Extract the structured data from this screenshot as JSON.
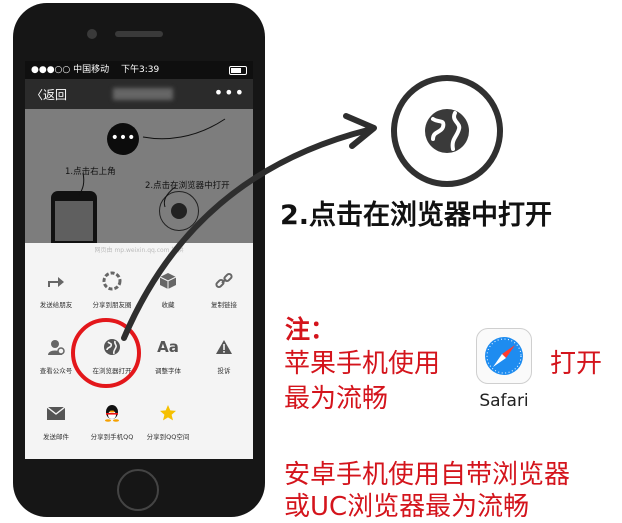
{
  "status_bar": {
    "carrier": "●●●○○ 中国移动 ",
    "time": "下午3:39"
  },
  "nav": {
    "back_label": "〈返回",
    "more_label": "•••"
  },
  "webview": {
    "step1_text": "1.点击右上角",
    "step2_text": "2.点击在浏览器中打开",
    "dots_label": "•••",
    "sheet_hint": "网页由 mp.weixin.qq.com 提供"
  },
  "menu": {
    "row1": [
      "发送给朋友",
      "分享到朋友圈",
      "收藏",
      "复制链接"
    ],
    "row2": [
      "查看公众号",
      "在浏览器打开",
      "调整字体",
      "投诉"
    ],
    "row3": [
      "发送邮件",
      "分享到手机QQ",
      "分享到QQ空间"
    ],
    "font_icon_text": "Aa"
  },
  "instruction": {
    "step2": "2.点击在浏览器中打开"
  },
  "notes": {
    "title": "注：",
    "apple_line1": "苹果手机使用",
    "apple_line2": "最为流畅",
    "open": "打开",
    "safari_label": "Safari",
    "android_line1": "安卓手机使用自带浏览器",
    "android_line2": "或UC浏览器最为流畅"
  },
  "colors": {
    "accent_red": "#d4141c",
    "highlight_red": "#e3171b",
    "dark": "#161616"
  }
}
